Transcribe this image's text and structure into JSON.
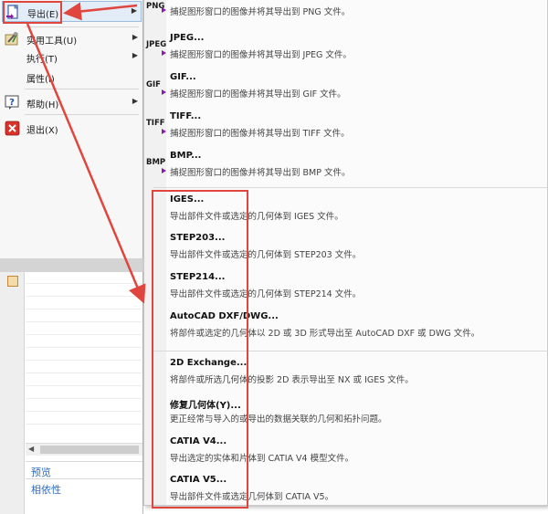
{
  "file_menu": {
    "items": [
      {
        "label": "导出(E)",
        "icon": "export-document-icon",
        "has_submenu": true
      },
      {
        "label": "实用工具(U)",
        "icon": "tools-icon",
        "has_submenu": true
      },
      {
        "label": "执行(T)",
        "icon": "",
        "has_submenu": true
      },
      {
        "label": "属性(I)",
        "icon": "",
        "has_submenu": false
      },
      {
        "label": "帮助(H)",
        "icon": "help-icon",
        "has_submenu": true
      },
      {
        "label": "退出(X)",
        "icon": "exit-icon",
        "has_submenu": false
      }
    ]
  },
  "background_panel": {
    "links": [
      "预览",
      "相依性"
    ]
  },
  "export_submenu": {
    "items": [
      {
        "title": "",
        "desc": "捕捉图形窗口的图像并将其导出到 PNG 文件。",
        "icon": "PNG"
      },
      {
        "title": "JPEG...",
        "desc": "捕捉图形窗口的图像并将其导出到 JPEG 文件。",
        "icon": "JPEG"
      },
      {
        "title": "GIF...",
        "desc": "捕捉图形窗口的图像并将其导出到 GIF 文件。",
        "icon": "GIF"
      },
      {
        "title": "TIFF...",
        "desc": "捕捉图形窗口的图像并将其导出到 TIFF 文件。",
        "icon": "TIFF"
      },
      {
        "title": "BMP...",
        "desc": "捕捉图形窗口的图像并将其导出到 BMP 文件。",
        "icon": "BMP"
      },
      {
        "title": "IGES...",
        "desc": "导出部件文件或选定的几何体到 IGES 文件。",
        "icon": ""
      },
      {
        "title": "STEP203...",
        "desc": "导出部件文件或选定的几何体到 STEP203 文件。",
        "icon": ""
      },
      {
        "title": "STEP214...",
        "desc": "导出部件文件或选定的几何体到 STEP214 文件。",
        "icon": ""
      },
      {
        "title": "AutoCAD DXF/DWG...",
        "desc": "将部件或选定的几何体以 2D 或 3D 形式导出至 AutoCAD DXF 或 DWG 文件。",
        "icon": ""
      },
      {
        "title": "2D Exchange...",
        "desc": "将部件或所选几何体的投影 2D 表示导出至 NX 或 IGES 文件。",
        "icon": ""
      },
      {
        "title": "修复几何体(Y)...",
        "desc": "更正经常与导入的或导出的数据关联的几何和拓扑问题。",
        "icon": ""
      },
      {
        "title": "CATIA V4...",
        "desc": "导出选定的实体和片体到 CATIA V4 模型文件。",
        "icon": ""
      },
      {
        "title": "CATIA V5...",
        "desc": "导出部件文件或选定几何体到 CATIA V5。",
        "icon": ""
      }
    ]
  },
  "colors": {
    "annotation_red": "#e0463d",
    "link_blue": "#2b6cc4",
    "format_marker": "#8b1aa8"
  }
}
